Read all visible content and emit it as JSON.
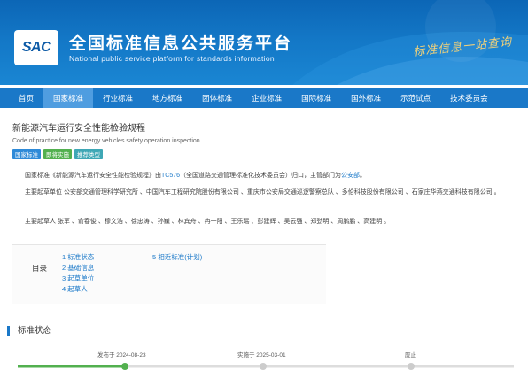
{
  "header": {
    "logo_text": "SAC",
    "title": "全国标准信息公共服务平台",
    "subtitle": "National public service platform  for standards information",
    "slogan": "标准信息一站查询"
  },
  "nav": {
    "items": [
      {
        "label": "首页",
        "active": false
      },
      {
        "label": "国家标准",
        "active": true
      },
      {
        "label": "行业标准",
        "active": false
      },
      {
        "label": "地方标准",
        "active": false
      },
      {
        "label": "团体标准",
        "active": false
      },
      {
        "label": "企业标准",
        "active": false
      },
      {
        "label": "国际标准",
        "active": false
      },
      {
        "label": "国外标准",
        "active": false
      },
      {
        "label": "示范试点",
        "active": false
      },
      {
        "label": "技术委员会",
        "active": false
      }
    ]
  },
  "document": {
    "title": "新能源汽车运行安全性能检验规程",
    "title_en": "Code of practice for new energy vehicles safety operation inspection",
    "tags": [
      {
        "label": "国家标准",
        "color": "#2e8ad8"
      },
      {
        "label": "即将实施",
        "color": "#52b04f"
      },
      {
        "label": "推荐类型",
        "color": "#3ea7b5"
      }
    ],
    "paragraph1": {
      "prefix": "国家标准《新能源汽车运行安全性能检验规程》由",
      "tc_link": "TC576",
      "middle": "（全国道路交通管理标准化技术委员会）归口，主管部门为",
      "dept_link": "公安部",
      "suffix": "。"
    },
    "paragraph2": "主要起草单位 公安部交通管理科学研究所 、中国汽车工程研究院股份有限公司 、重庆市公安局交通巡逻警察总队 、多伦科技股份有限公司 、石家庄华燕交通科技有限公司 。",
    "paragraph3": "主要起草人 张军 、俞春俊 、穆文浩 、徐忠涛 、孙巍 、林宾舟 、冉一阳 、王乐瑶 、彭建辉 、吴云强 、郑劲明 、周鹏鹏 、高建明 。"
  },
  "toc": {
    "label": "目录",
    "items_left": [
      "1  标准状态",
      "2  基础信息",
      "3  起草单位",
      "4  起草人"
    ],
    "items_right": [
      "5  相近标准(计划)"
    ]
  },
  "status": {
    "title": "标准状态",
    "milestones": [
      {
        "label": "发布于 2024-08-23",
        "done": true
      },
      {
        "label": "实施于 2025-03-01",
        "done": false
      },
      {
        "label": "废止",
        "done": false
      }
    ]
  },
  "colors": {
    "accent": "#1a78c8",
    "nav_active": "#4f9de0",
    "done": "#52b04f"
  }
}
